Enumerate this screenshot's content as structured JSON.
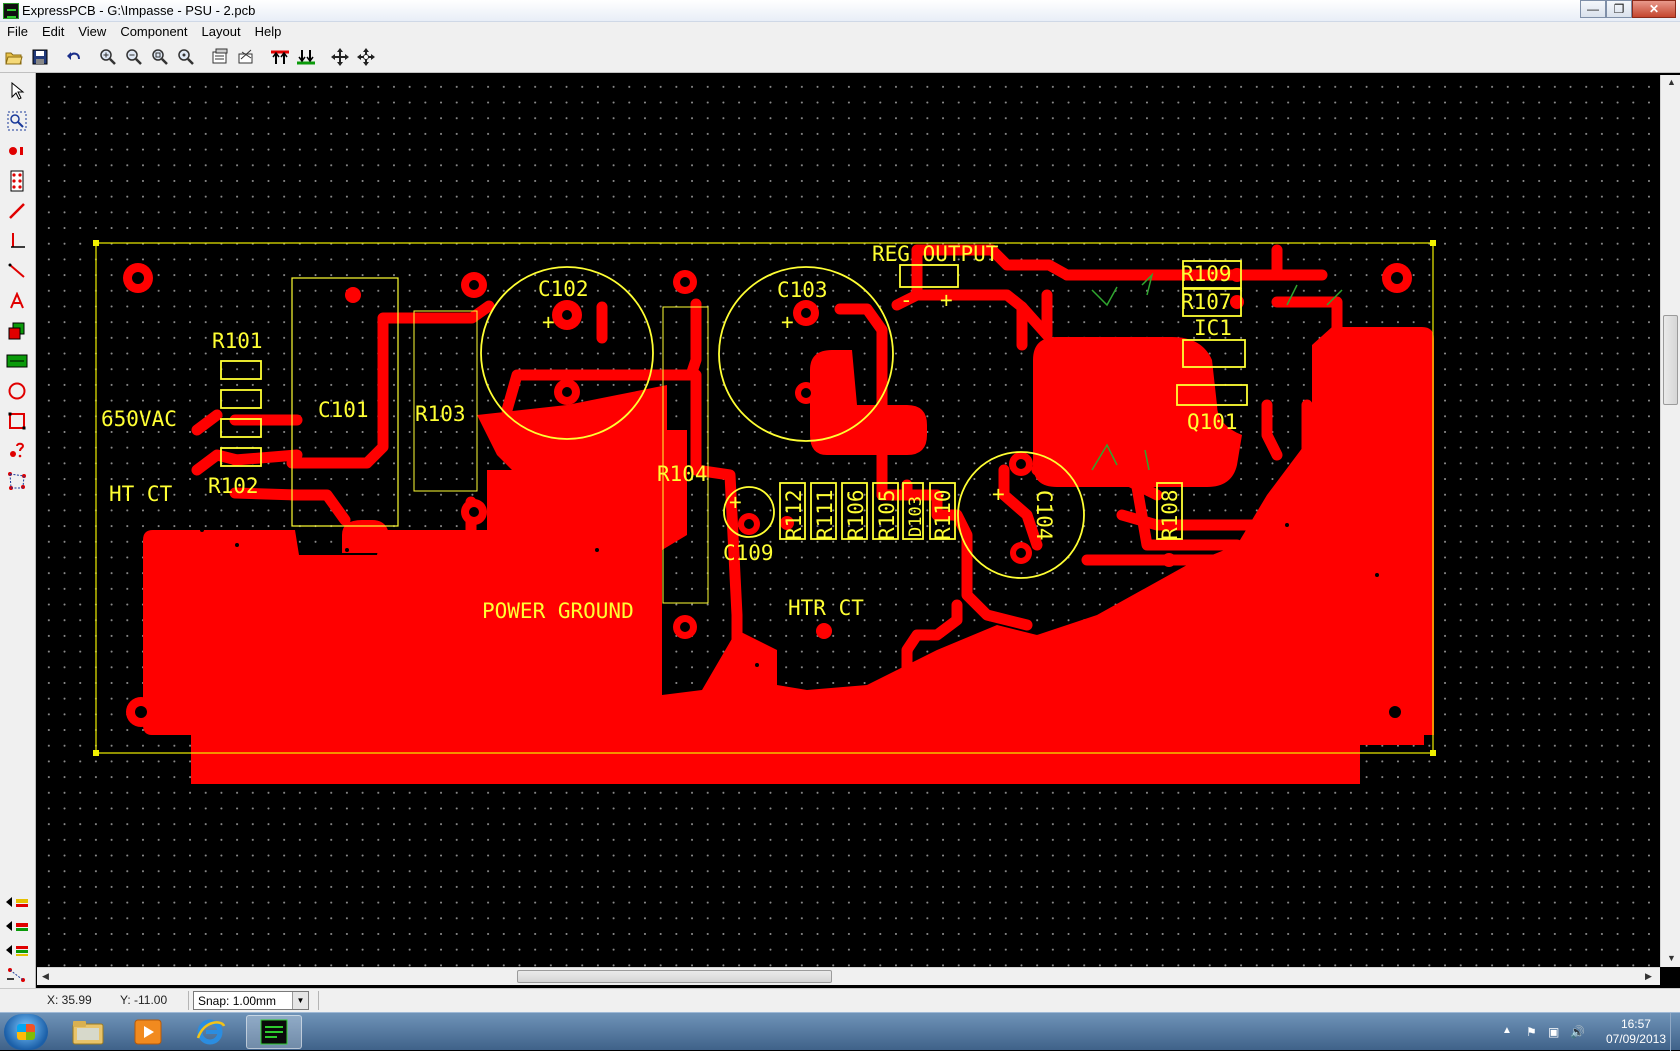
{
  "window": {
    "title": "ExpressPCB - G:\\Impasse - PSU - 2.pcb"
  },
  "menu": {
    "items": [
      "File",
      "Edit",
      "View",
      "Component",
      "Layout",
      "Help"
    ]
  },
  "toolbar": {
    "buttons": [
      "open-icon",
      "save-icon",
      "undo-icon",
      "zoom-in-icon",
      "zoom-out-icon",
      "zoom-fit-icon",
      "zoom-board-icon",
      "properties-icon",
      "layer-icon",
      "top-layer-icon",
      "bottom-layer-icon",
      "move-icon",
      "pan-icon"
    ]
  },
  "palette": {
    "tools": [
      "select-icon",
      "zoom-select-icon",
      "pad-icon",
      "component-icon",
      "trace-icon",
      "vertical-trace-icon",
      "diagonal-trace-icon",
      "text-icon",
      "filled-shape-icon",
      "ground-plane-icon",
      "circle-icon",
      "rectangle-icon",
      "help-icon",
      "net-icon"
    ],
    "layers": [
      "top-layer-toggle-icon",
      "bottom-layer-toggle-icon",
      "silkscreen-layer-toggle-icon",
      "ratsnest-toggle-icon"
    ]
  },
  "pcb": {
    "labels": {
      "reg_output": "REG OUTPUT",
      "vac": "650VAC",
      "ht_ct": "HT CT",
      "power_ground": "POWER GROUND",
      "htr_ct": "HTR CT",
      "r101": "R101",
      "r102": "R102",
      "r103": "R103",
      "r104": "R104",
      "r105": "R105",
      "r106": "R106",
      "r110": "R110",
      "r111": "R111",
      "r112": "R112",
      "r108": "R108",
      "r109": "R109",
      "r107": "R107",
      "c101": "C101",
      "c102": "C102",
      "c103": "C103",
      "c104": "C104",
      "c109": "C109",
      "ic1": "IC1",
      "q101": "Q101",
      "d103": "D103",
      "plus": "+",
      "minus": "-"
    },
    "colors": {
      "copper": "#ff0000",
      "silkscreen": "#ffff33",
      "board_outline": "#f0f000",
      "ratsnest": "#2fa62f",
      "grid_dot": "#8a8a8a"
    }
  },
  "status": {
    "x": "X: 35.99",
    "y": "Y: -11.00",
    "snap": "Snap: 1.00mm"
  },
  "taskbar": {
    "apps": [
      "explorer-icon",
      "media-player-icon",
      "internet-explorer-icon",
      "expresspcb-icon"
    ],
    "time": "16:57",
    "date": "07/09/2013"
  }
}
